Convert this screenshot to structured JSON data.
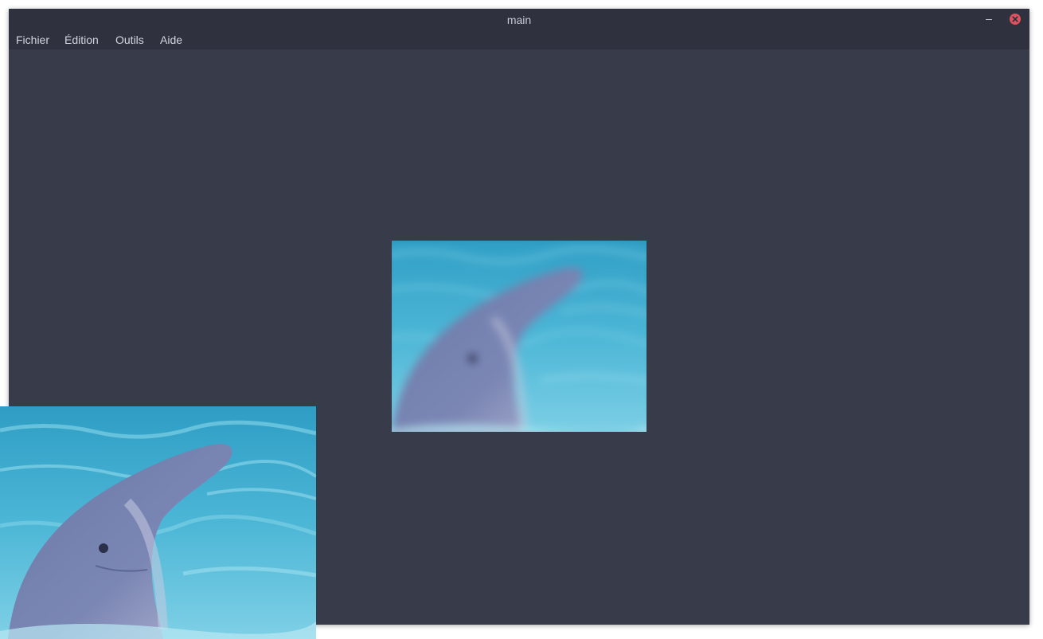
{
  "window": {
    "title": "main",
    "minimize_label": "–"
  },
  "menu": {
    "items": [
      "Fichier",
      "Édition",
      "Outils",
      "Aide"
    ]
  },
  "icons": {
    "minimize": "minimize-icon",
    "close": "close-icon"
  },
  "colors": {
    "background": "#383b49",
    "titlebar": "#2f323e",
    "close_button": "#e0525f",
    "water": "#3fa7c9"
  }
}
